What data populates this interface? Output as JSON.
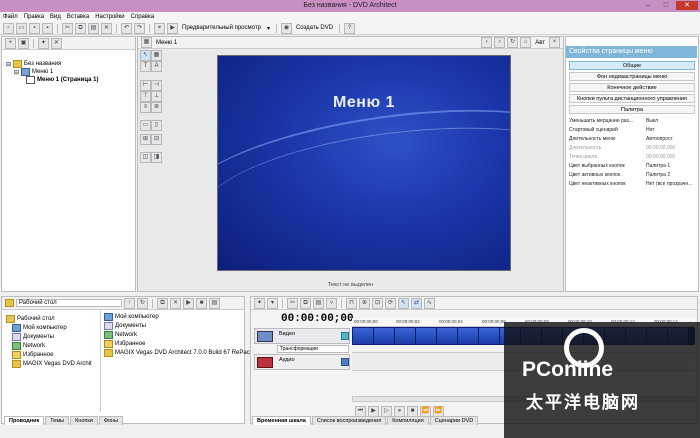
{
  "window": {
    "title": "Без названия - DVD Architect"
  },
  "menubar": [
    "Файл",
    "Правка",
    "Вид",
    "Вставка",
    "Настройки",
    "Справка"
  ],
  "toolbar": {
    "preview": "Предварительный просмотр",
    "make_dvd": "Создать DVD"
  },
  "project_tree": {
    "root": "Без названия",
    "child": "Меню 1",
    "page": "Меню 1 (Страница 1)"
  },
  "workspace": {
    "tab": "Меню 1",
    "zoom": "Авт",
    "menu_title": "Меню 1",
    "status": "Текст не выделен"
  },
  "properties": {
    "header": "Свойства страницы меню",
    "buttons": [
      "Общие",
      "Фон недиаастраницы меню",
      "Конечное действие",
      "Кнопки пульта дистанционного управления",
      "Палитра"
    ],
    "rows": [
      {
        "k": "Уменьшить мерцание раз...",
        "v": "Выкл",
        "dim": false
      },
      {
        "k": "Стартовый сценарий",
        "v": "Нет",
        "dim": false
      },
      {
        "k": "Длительность меню",
        "v": "Автоопрост",
        "dim": false
      },
      {
        "k": "Длительность",
        "v": "00:00:00,000",
        "dim": true
      },
      {
        "k": "Точка цикла",
        "v": "00:00:00,000",
        "dim": true
      },
      {
        "k": "Цвет выбранных кнопок",
        "v": "Палитра 1",
        "dim": false
      },
      {
        "k": "Цвет активных кнопок",
        "v": "Палитра 2",
        "dim": false
      },
      {
        "k": "Цвет неактивных кнопок",
        "v": "Нет (все прозрачн...",
        "dim": false
      }
    ]
  },
  "explorer": {
    "location": "Рабочий стол",
    "tree": [
      "Рабочий стол",
      "Мой компьютер",
      "Документы",
      "Network",
      "Избранное",
      "MAGIX Vegas DVD Archit"
    ],
    "files": [
      "Мой компьютер",
      "Документы",
      "Network",
      "Избранное",
      "MAGIX Vegas DVD Architect 7.0.0 Build 67 RePack"
    ],
    "tabs": [
      "Проводник",
      "Темы",
      "Кнопки",
      "Фоны"
    ]
  },
  "timeline": {
    "timecode": "00:00:00;00",
    "tracks": {
      "video": "Видео",
      "transform": "Трансформации",
      "audio": "Аудио"
    },
    "ruler": [
      "00:00:00;00",
      "00:00:00;02",
      "00:00:00;04",
      "00:00:00;06",
      "00:00:00;08",
      "00:00:00;10",
      "00:00:00;12",
      "00:00:00;14"
    ],
    "tabs": [
      "Временная шкала",
      "Список воспроизведения",
      "Компиляция",
      "Сценарии DVD"
    ]
  },
  "watermark": {
    "brand": "PConline",
    "cn": "太平洋电脑网"
  }
}
